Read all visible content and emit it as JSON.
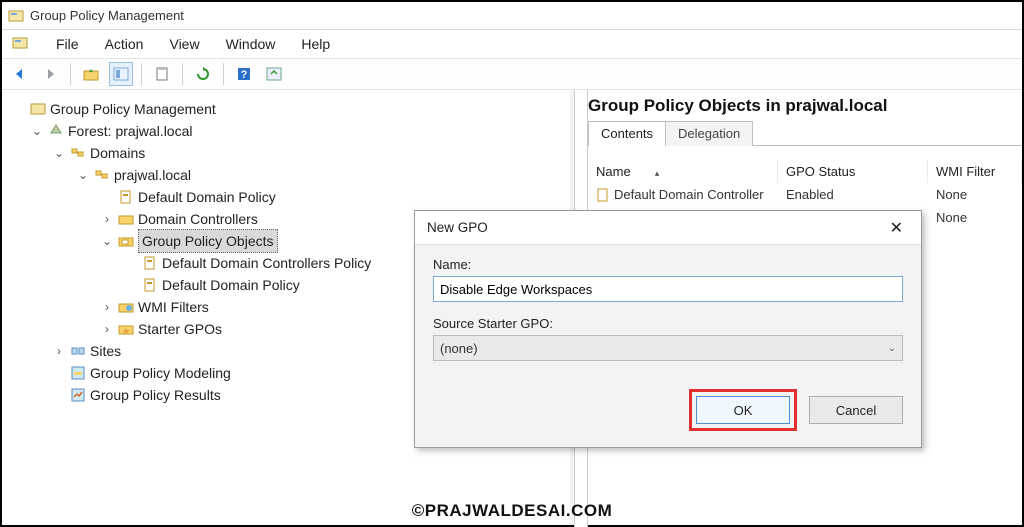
{
  "window": {
    "title": "Group Policy Management"
  },
  "menu": {
    "file": "File",
    "action": "Action",
    "view": "View",
    "window": "Window",
    "help": "Help"
  },
  "tree": {
    "root": "Group Policy Management",
    "forest": "Forest: prajwal.local",
    "domains": "Domains",
    "domain": "prajwal.local",
    "default_domain_policy": "Default Domain Policy",
    "domain_controllers": "Domain Controllers",
    "gpo_container": "Group Policy Objects",
    "gpo_ddc": "Default Domain Controllers Policy",
    "gpo_ddp": "Default Domain Policy",
    "wmi": "WMI Filters",
    "starter": "Starter GPOs",
    "sites": "Sites",
    "modeling": "Group Policy Modeling",
    "results": "Group Policy Results"
  },
  "detail": {
    "title": "Group Policy Objects in prajwal.local",
    "tabs": {
      "contents": "Contents",
      "delegation": "Delegation"
    },
    "columns": {
      "name": "Name",
      "status": "GPO Status",
      "wmi": "WMI Filter"
    },
    "rows": [
      {
        "name": "Default Domain Controller",
        "status": "Enabled",
        "wmi": "None"
      },
      {
        "name": "",
        "status": "",
        "wmi": "None"
      }
    ]
  },
  "dialog": {
    "title": "New GPO",
    "name_label": "Name:",
    "name_value": "Disable Edge Workspaces",
    "source_label": "Source Starter GPO:",
    "source_value": "(none)",
    "ok": "OK",
    "cancel": "Cancel"
  },
  "watermark": "©PRAJWALDESAI.COM"
}
